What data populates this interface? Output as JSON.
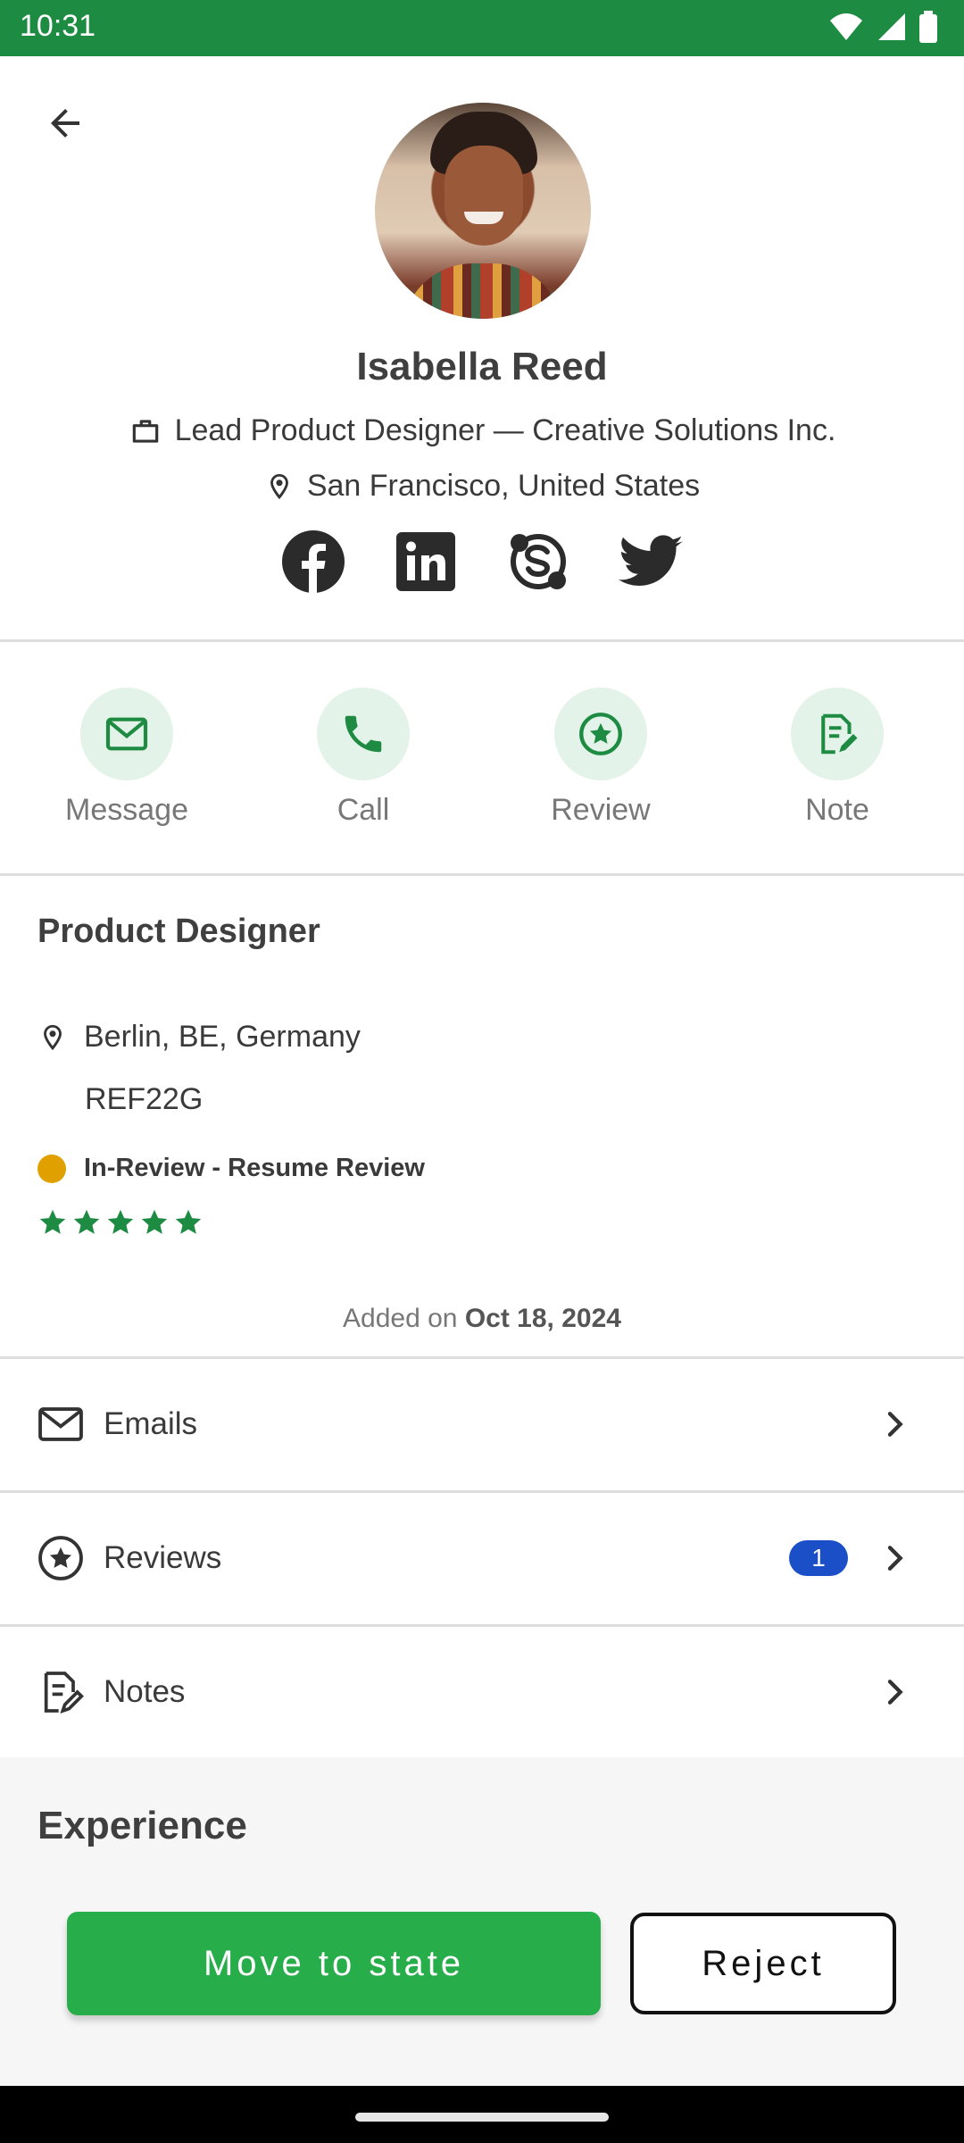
{
  "status_bar": {
    "time": "10:31"
  },
  "profile": {
    "name": "Isabella Reed",
    "job_line": "Lead Product Designer — Creative Solutions Inc.",
    "location": "San Francisco, United States",
    "socials": [
      "facebook-icon",
      "linkedin-icon",
      "skype-icon",
      "twitter-icon"
    ]
  },
  "actions": [
    {
      "label": "Message",
      "icon": "mail-icon"
    },
    {
      "label": "Call",
      "icon": "phone-icon"
    },
    {
      "label": "Review",
      "icon": "star-circle-icon"
    },
    {
      "label": "Note",
      "icon": "note-edit-icon"
    }
  ],
  "job": {
    "title": "Product Designer",
    "location": "Berlin, BE, Germany",
    "ref": "REF22G",
    "status": "In-Review - Resume Review",
    "status_color": "#e0a000",
    "rating": {
      "value": 5,
      "max": 5
    },
    "added_prefix": "Added on",
    "added_date": "Oct 18, 2024"
  },
  "list": {
    "emails": {
      "label": "Emails"
    },
    "reviews": {
      "label": "Reviews",
      "badge": "1"
    },
    "notes": {
      "label": "Notes"
    }
  },
  "experience": {
    "title": "Experience"
  },
  "buttons": {
    "move": "Move to state",
    "reject": "Reject"
  },
  "colors": {
    "accent": "#27ad4a",
    "status_bar": "#1e8b43",
    "badge": "#1a4fc7"
  }
}
